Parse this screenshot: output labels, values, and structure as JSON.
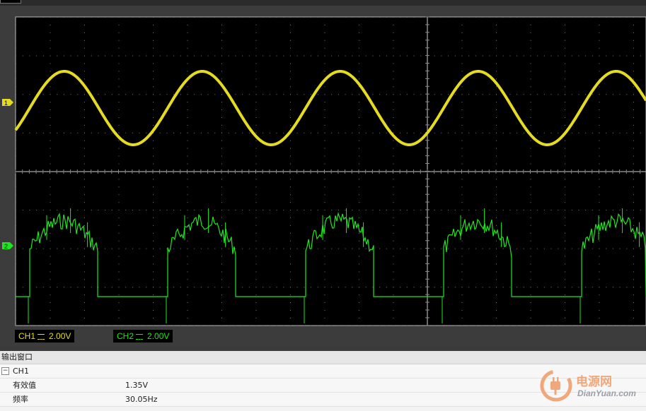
{
  "oscilloscope": {
    "channels": [
      {
        "id": "CH1",
        "marker": "1",
        "color": "#e6dc1e",
        "coupling_icon": "dc-coupling-icon",
        "scale": "2.00V"
      },
      {
        "id": "CH2",
        "marker": "2",
        "color": "#1ee61e",
        "coupling_icon": "dc-coupling-icon",
        "scale": "2.00V"
      }
    ],
    "colors": {
      "screen": "#000000",
      "grid": "#8a8a8a",
      "frame": "#3c3c3c"
    }
  },
  "output_window": {
    "title": "输出窗口",
    "group": {
      "toggle": "⊟",
      "name": "CH1"
    },
    "rows": [
      {
        "name": "有效值",
        "value": "1.35V"
      },
      {
        "name": "频率",
        "value": "30.05Hz"
      }
    ]
  },
  "watermark": {
    "brand": "电源网",
    "site": "DianYuan.com",
    "accent": "#f0a87a"
  }
}
